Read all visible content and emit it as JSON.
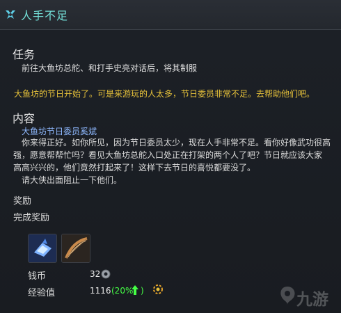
{
  "window": {
    "title": "人手不足",
    "title_icon": "quest-icon"
  },
  "task": {
    "heading": "任务",
    "objective": "前往大鱼坊总舵、和打手史亮对话后，将其制服"
  },
  "intro": "大鱼坊的节日开始了。可是来游玩的人太多，节日委员非常不足。去帮助他们吧。",
  "content": {
    "heading": "内容",
    "speaker": "大鱼坊节日委员奚斌",
    "lines": [
      "你来得正好。如你所见，因为节日委员太少，现在人手非常不足。看你好像武功很高",
      "强，愿意帮帮忙吗？看见大鱼坊总舵入口处正在打架的两个人了吧？节日就应该大家",
      "高高兴兴的，他们竟然打起来了！这样下去节日的喜悦都要没了。",
      "请大侠出面阻止一下他们。"
    ]
  },
  "rewards": {
    "heading": "奖励",
    "completion_heading": "完成奖励",
    "items": [
      {
        "name": "blue-ornament-item",
        "icon": "crystal-icon"
      },
      {
        "name": "bow-item",
        "icon": "bow-icon"
      }
    ],
    "coin_label": "钱币",
    "coin_value": "32",
    "exp_label": "经验值",
    "exp_value": "1116",
    "exp_bonus": "(20%",
    "exp_bonus_close": ")",
    "colors": {
      "accent": "#73dfd7",
      "yellow": "#e7c23a",
      "green": "#45ff45",
      "blue": "#8fb9ff"
    }
  },
  "watermark": {
    "text": "九游"
  }
}
